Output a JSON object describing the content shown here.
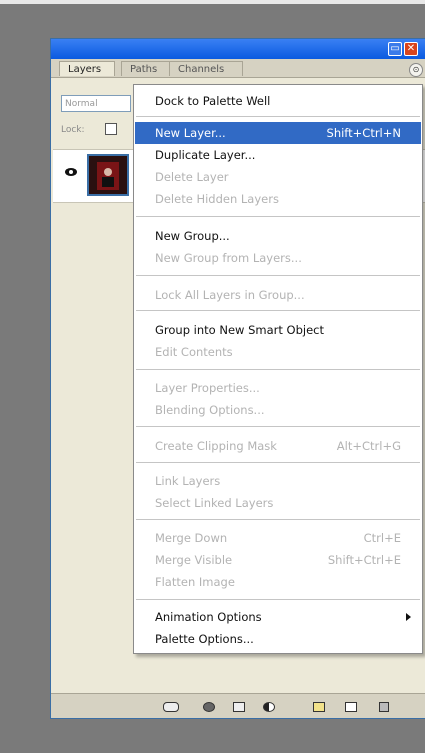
{
  "palette": {
    "tabs": [
      "Layers",
      "Paths",
      "Channels"
    ],
    "blend_mode": "Normal",
    "lock_label": "Lock:",
    "menu_button_glyph": "⊙"
  },
  "menu": {
    "items": [
      {
        "label": "Dock to Palette Well",
        "shortcut": "",
        "disabled": false
      },
      {
        "label": "New Layer...",
        "shortcut": "Shift+Ctrl+N",
        "disabled": false,
        "selected": true
      },
      {
        "label": "Duplicate Layer...",
        "shortcut": "",
        "disabled": false
      },
      {
        "label": "Delete Layer",
        "shortcut": "",
        "disabled": true
      },
      {
        "label": "Delete Hidden Layers",
        "shortcut": "",
        "disabled": true
      },
      {
        "label": "New Group...",
        "shortcut": "",
        "disabled": false
      },
      {
        "label": "New Group from Layers...",
        "shortcut": "",
        "disabled": true
      },
      {
        "label": "Lock All Layers in Group...",
        "shortcut": "",
        "disabled": true
      },
      {
        "label": "Group into New Smart Object",
        "shortcut": "",
        "disabled": false
      },
      {
        "label": "Edit Contents",
        "shortcut": "",
        "disabled": true
      },
      {
        "label": "Layer Properties...",
        "shortcut": "",
        "disabled": true
      },
      {
        "label": "Blending Options...",
        "shortcut": "",
        "disabled": true
      },
      {
        "label": "Create Clipping Mask",
        "shortcut": "Alt+Ctrl+G",
        "disabled": true
      },
      {
        "label": "Link Layers",
        "shortcut": "",
        "disabled": true
      },
      {
        "label": "Select Linked Layers",
        "shortcut": "",
        "disabled": true
      },
      {
        "label": "Merge Down",
        "shortcut": "Ctrl+E",
        "disabled": true
      },
      {
        "label": "Merge Visible",
        "shortcut": "Shift+Ctrl+E",
        "disabled": true
      },
      {
        "label": "Flatten Image",
        "shortcut": "",
        "disabled": true
      },
      {
        "label": "Animation Options",
        "shortcut": "",
        "disabled": false,
        "submenu": true
      },
      {
        "label": "Palette Options...",
        "shortcut": "",
        "disabled": false
      }
    ]
  }
}
